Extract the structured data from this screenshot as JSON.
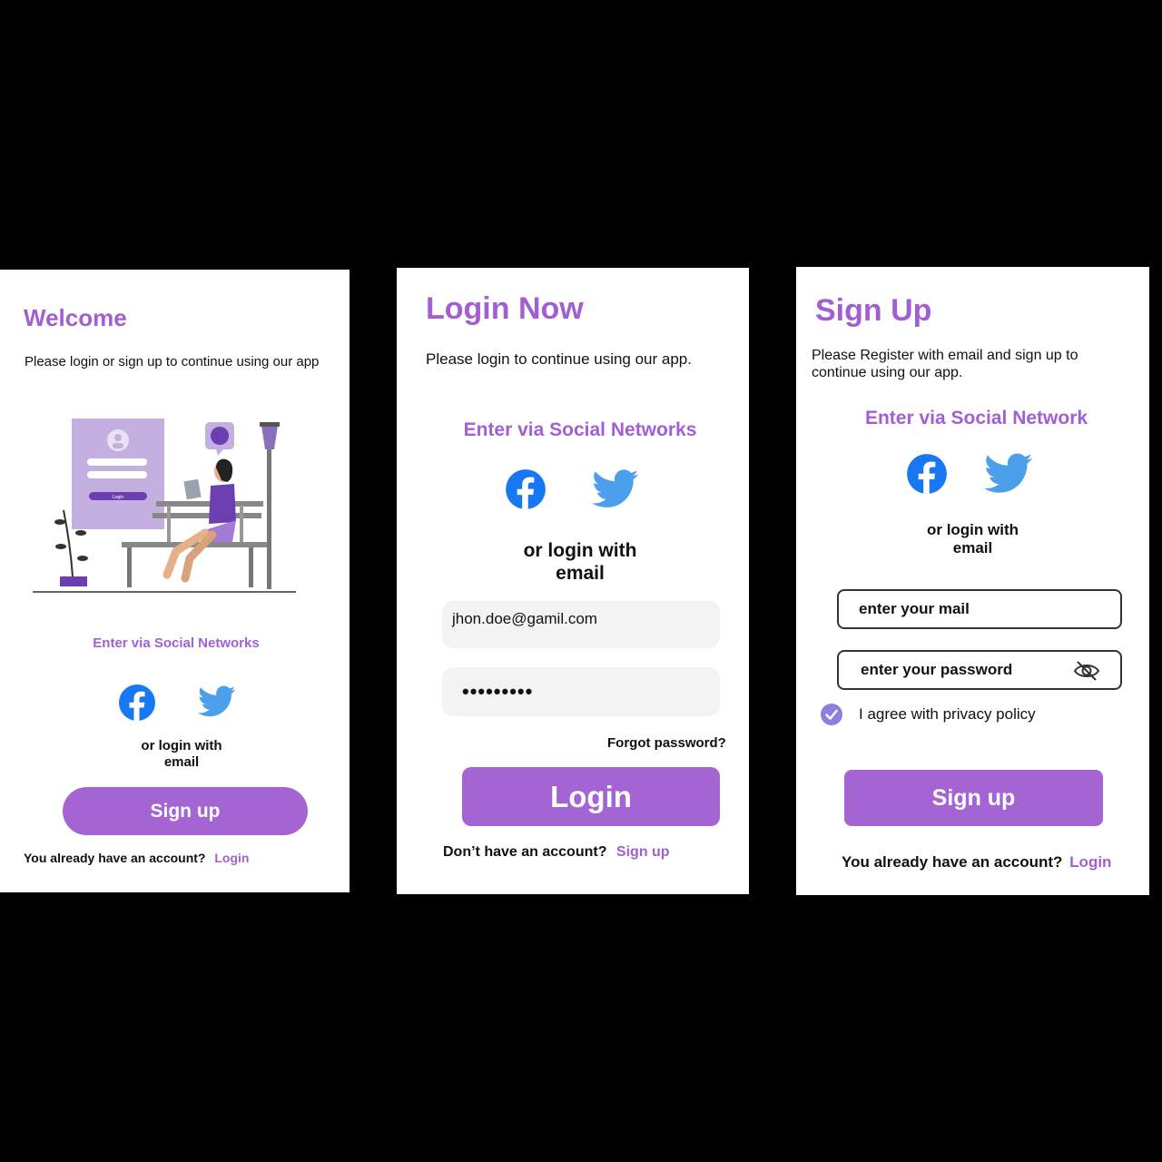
{
  "welcome": {
    "title": "Welcome",
    "subtitle": "Please login or sign up to continue using our app",
    "illustration": {
      "mini_login_button": "Login"
    },
    "social_heading": "Enter via Social Networks",
    "or_login_line1": "or login with",
    "or_login_line2": "email",
    "signup_button": "Sign up",
    "footer_text": "You already have an account?",
    "footer_link": "Login"
  },
  "login": {
    "title": "Login Now",
    "subtitle": "Please login to continue using our app.",
    "social_heading": "Enter via Social Networks",
    "or_login_line1": "or login with",
    "or_login_line2": "email",
    "email_value": "jhon.doe@gamil.com",
    "password_mask": "•••••••••",
    "forgot_password": "Forgot password?",
    "login_button": "Login",
    "footer_text": "Don’t have an account?",
    "footer_link": "Sign up"
  },
  "signup": {
    "title": "Sign Up",
    "subtitle_line1": "Please Register with email and sign up to",
    "subtitle_line2": "continue using our app.",
    "social_heading": "Enter via Social Network",
    "or_login_line1": "or login with",
    "or_login_line2": "email",
    "email_placeholder": "enter your mail",
    "password_placeholder": "enter your password",
    "agree_label": "I agree with privacy policy",
    "agree_checked": true,
    "signup_button": "Sign up",
    "footer_text": "You already have an account?",
    "footer_link": "Login"
  },
  "colors": {
    "accent": "#a464d4",
    "facebook": "#1877f2",
    "twitter": "#4ca0eb",
    "background": "#000000"
  },
  "icons": [
    "facebook-icon",
    "twitter-icon",
    "eye-slash-icon",
    "checkbox-check-icon"
  ]
}
